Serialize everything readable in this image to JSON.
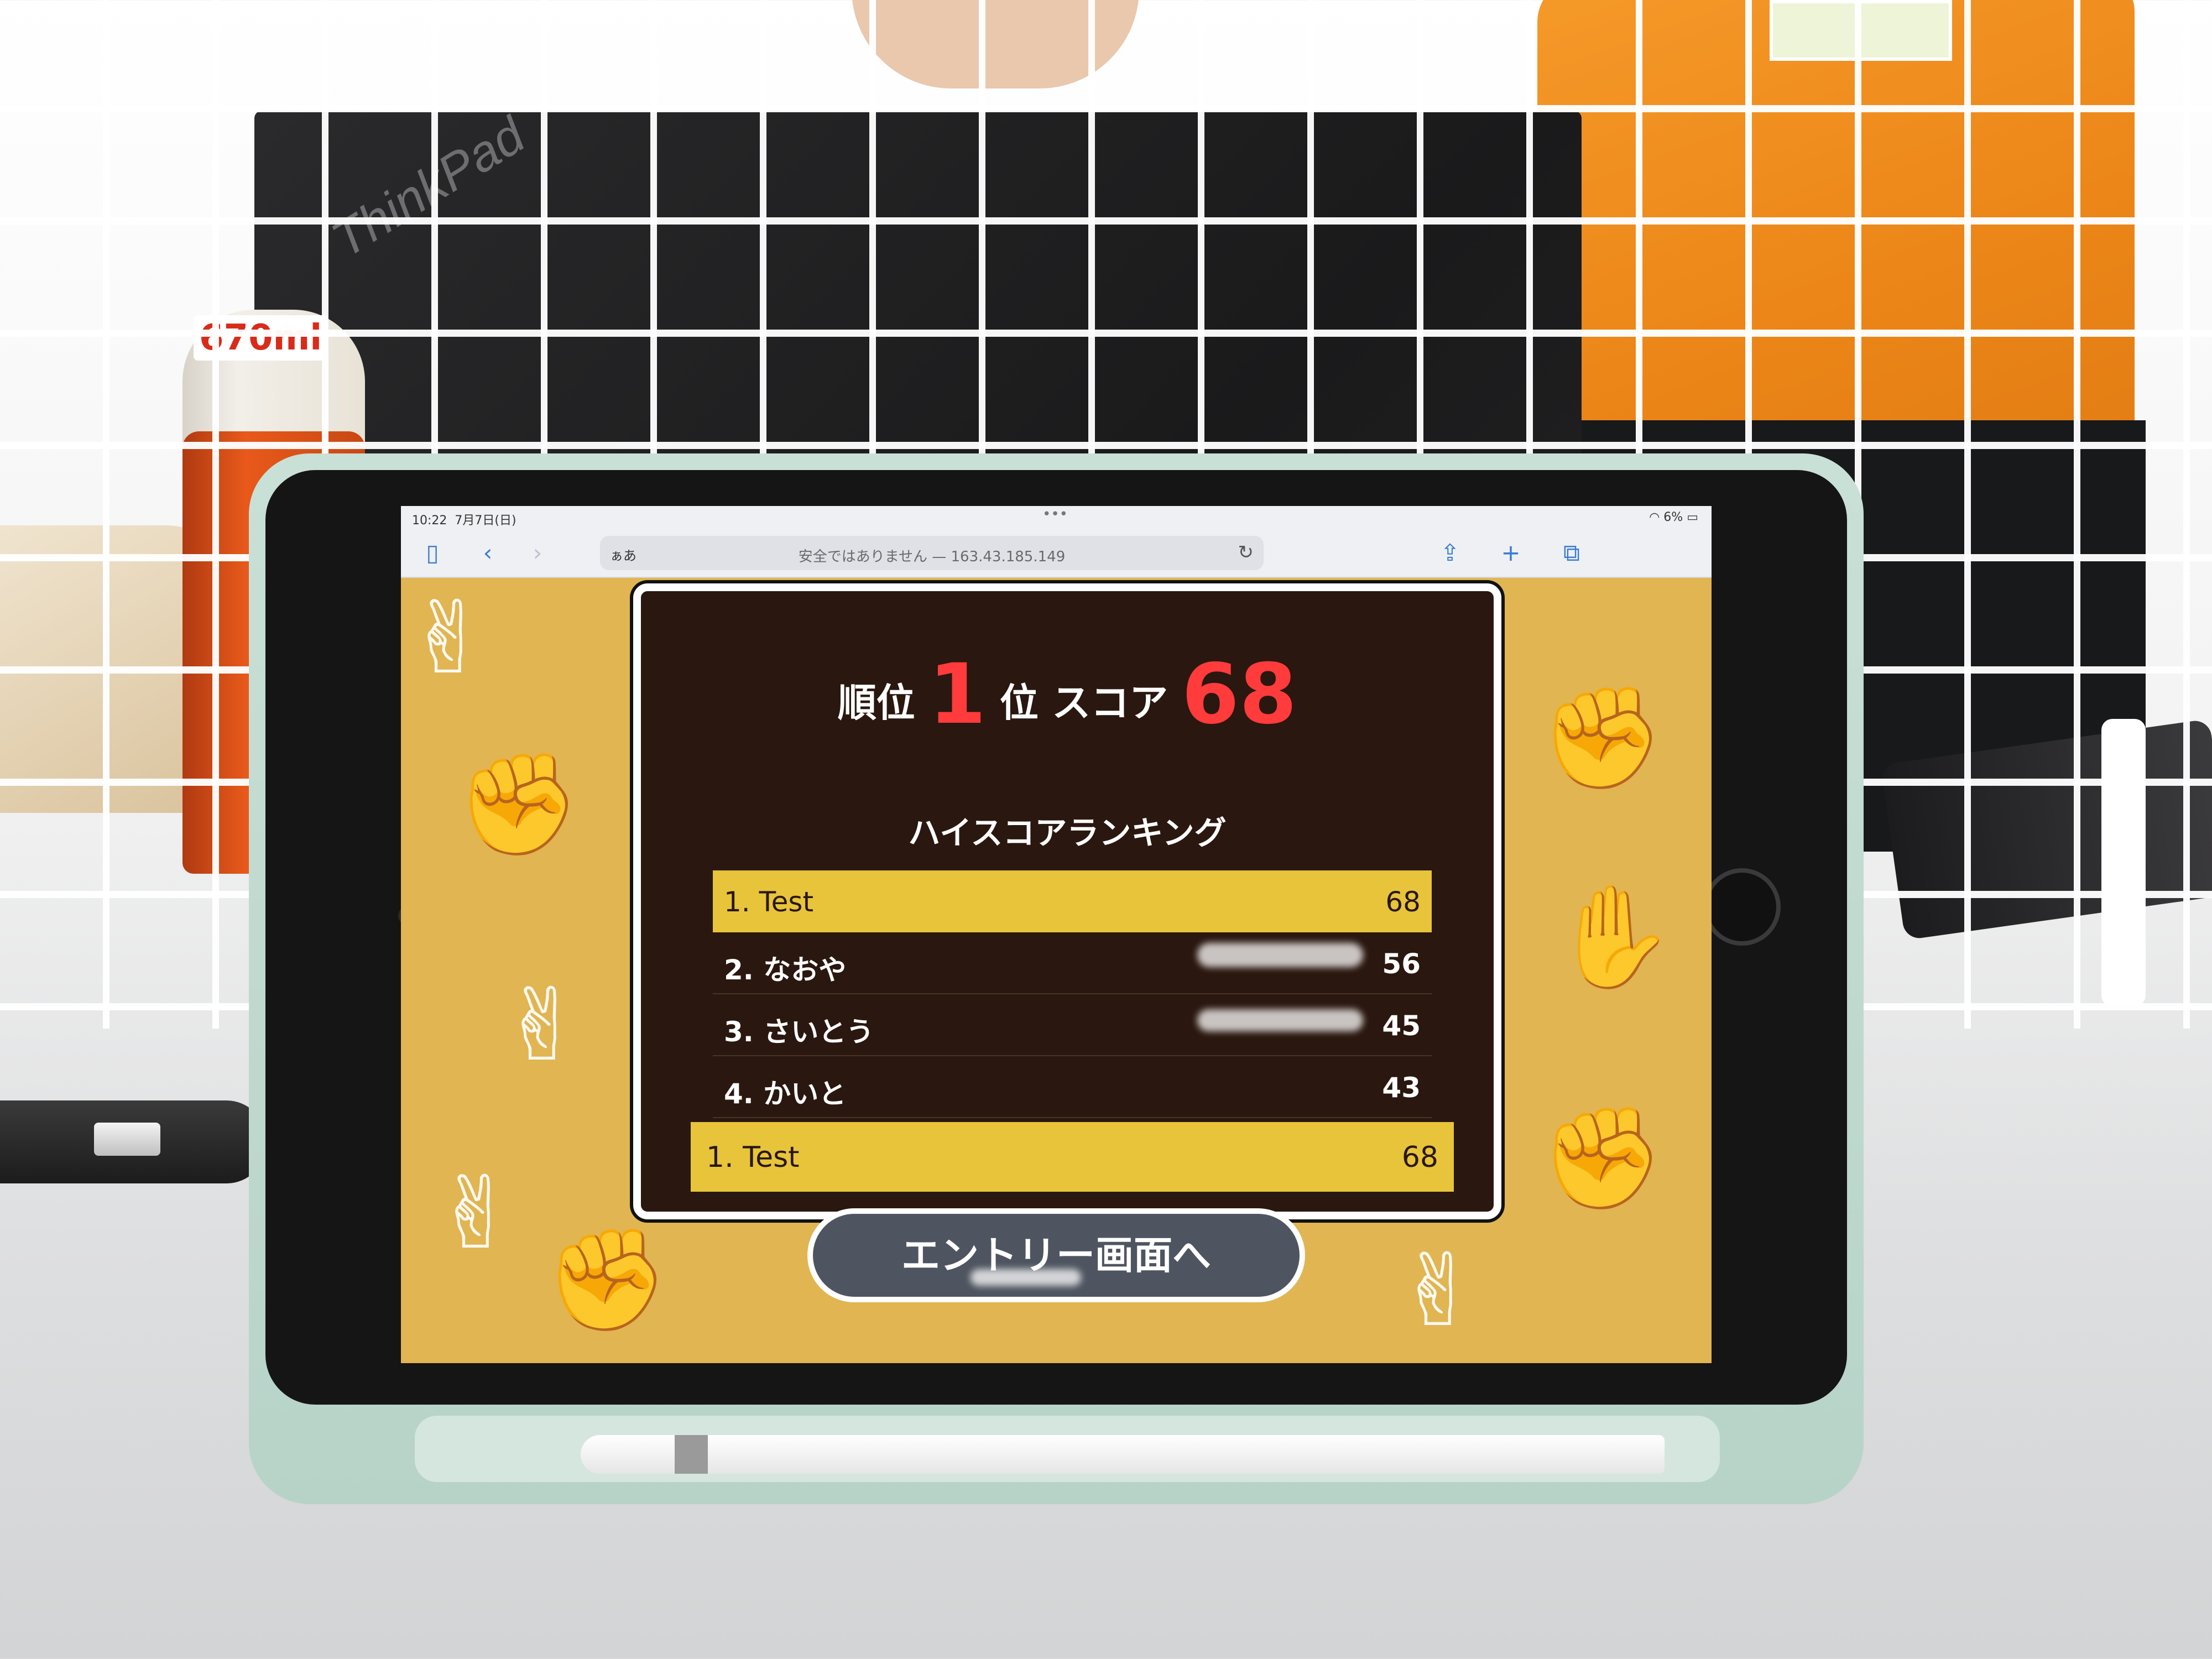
{
  "scene": {
    "laptop_brand": "ThinkPad",
    "bottle_label": "670ml"
  },
  "status": {
    "time": "10:22",
    "date": "7月7日(日)",
    "battery": "6%"
  },
  "browser": {
    "text_size_button": "ぁあ",
    "address": "安全ではありません — 163.43.185.149",
    "icons": [
      "sidebar-icon",
      "back-icon",
      "forward-icon",
      "reload-icon",
      "share-icon",
      "new-tab-icon",
      "tabs-icon"
    ]
  },
  "result": {
    "rank_label": "順位",
    "rank_value": "1",
    "rank_suffix": "位",
    "score_label": "スコア",
    "score_value": "68"
  },
  "ranking": {
    "title": "ハイスコアランキング",
    "rows": [
      {
        "name": "1. Test",
        "score": "68"
      },
      {
        "name": "2. なおや",
        "score": "56"
      },
      {
        "name": "3. さいとう",
        "score": "45"
      },
      {
        "name": "4. かいと",
        "score": "43"
      }
    ],
    "current": {
      "name": "1. Test",
      "score": "68"
    }
  },
  "entry_button": "エントリー画面へ",
  "colors": {
    "page_background": "#e0b552",
    "panel": "#2a170f",
    "highlight": "#e7c43a",
    "accent_red": "#ff3b3b"
  }
}
